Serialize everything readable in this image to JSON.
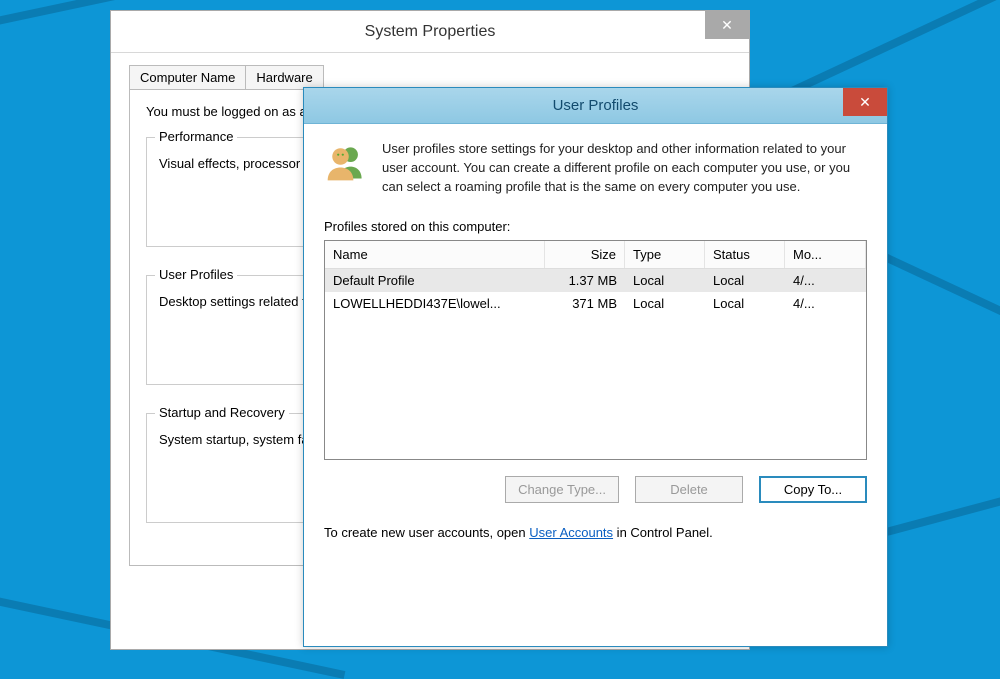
{
  "sys": {
    "title": "System Properties",
    "tabs": [
      "Computer Name",
      "Hardware"
    ],
    "logtext": "You must be logged on as an Administrator to make most of these changes.",
    "group1": {
      "title": "Performance",
      "text": "Visual effects, processor scheduling, memory usage, and virtual memory"
    },
    "group2": {
      "title": "User Profiles",
      "text": "Desktop settings related to your sign-in"
    },
    "group3": {
      "title": "Startup and Recovery",
      "text": "System startup, system failure, and debugging information"
    }
  },
  "up": {
    "title": "User Profiles",
    "intro": "User profiles store settings for your desktop and other information related to your user account. You can create a different profile on each computer you use, or you can select a roaming profile that is the same on every computer you use.",
    "profiles_label": "Profiles stored on this computer:",
    "headers": {
      "name": "Name",
      "size": "Size",
      "type": "Type",
      "status": "Status",
      "mod": "Mo..."
    },
    "rows": [
      {
        "name": "Default Profile",
        "size": "1.37 MB",
        "type": "Local",
        "status": "Local",
        "mod": "4/..."
      },
      {
        "name": "LOWELLHEDDI437E\\lowel...",
        "size": "371 MB",
        "type": "Local",
        "status": "Local",
        "mod": "4/..."
      }
    ],
    "buttons": {
      "change": "Change Type...",
      "delete": "Delete",
      "copy": "Copy To..."
    },
    "footer_pre": "To create new user accounts, open ",
    "footer_link": "User Accounts",
    "footer_post": " in Control Panel."
  }
}
